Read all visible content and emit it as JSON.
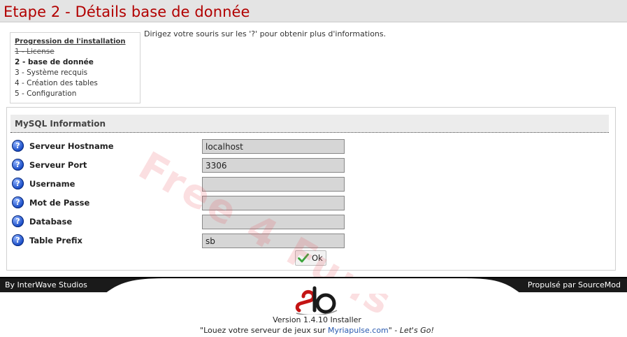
{
  "page": {
    "title": "Etape 2 - Détails base de donnée"
  },
  "progress": {
    "title": "Progression de l'installation",
    "steps": [
      {
        "label": "1 - License",
        "state": "done"
      },
      {
        "label": "2 - base de donnée",
        "state": "current"
      },
      {
        "label": "3 - Système recquis",
        "state": "pending"
      },
      {
        "label": "4 - Création des tables",
        "state": "pending"
      },
      {
        "label": "5 - Configuration",
        "state": "pending"
      }
    ]
  },
  "help_text": "Dirigez votre souris sur les '?' pour obtenir plus d'informations.",
  "watermark": "Free 4 Funs",
  "mysql": {
    "section_title": "MySQL Information",
    "fields": [
      {
        "label": "Serveur Hostname",
        "value": "localhost"
      },
      {
        "label": "Serveur Port",
        "value": "3306"
      },
      {
        "label": "Username",
        "value": ""
      },
      {
        "label": "Mot de Passe",
        "value": ""
      },
      {
        "label": "Database",
        "value": ""
      },
      {
        "label": "Table Prefix",
        "value": "sb"
      }
    ],
    "help_icon": "question-mark-icon",
    "submit_label": "Ok",
    "submit_icon": "checkmark-icon"
  },
  "footer": {
    "left": "By InterWave Studios",
    "right": "Propulsé par SourceMod",
    "logo_icon": "sb-logo-icon",
    "version": "Version 1.4.10 Installer",
    "tagline_prefix": "\"Louez votre serveur de jeux sur ",
    "tagline_link": "Myriapulse.com",
    "tagline_middle": "\" - ",
    "tagline_italic": "Let's Go!"
  },
  "colors": {
    "title_red": "#b20000",
    "header_bg": "#e4e4e4",
    "footer_bg": "#1a1a1a",
    "link_blue": "#2a5bb0",
    "input_bg": "#d6d6d6",
    "help_icon_blue": "#1c4fc8"
  }
}
